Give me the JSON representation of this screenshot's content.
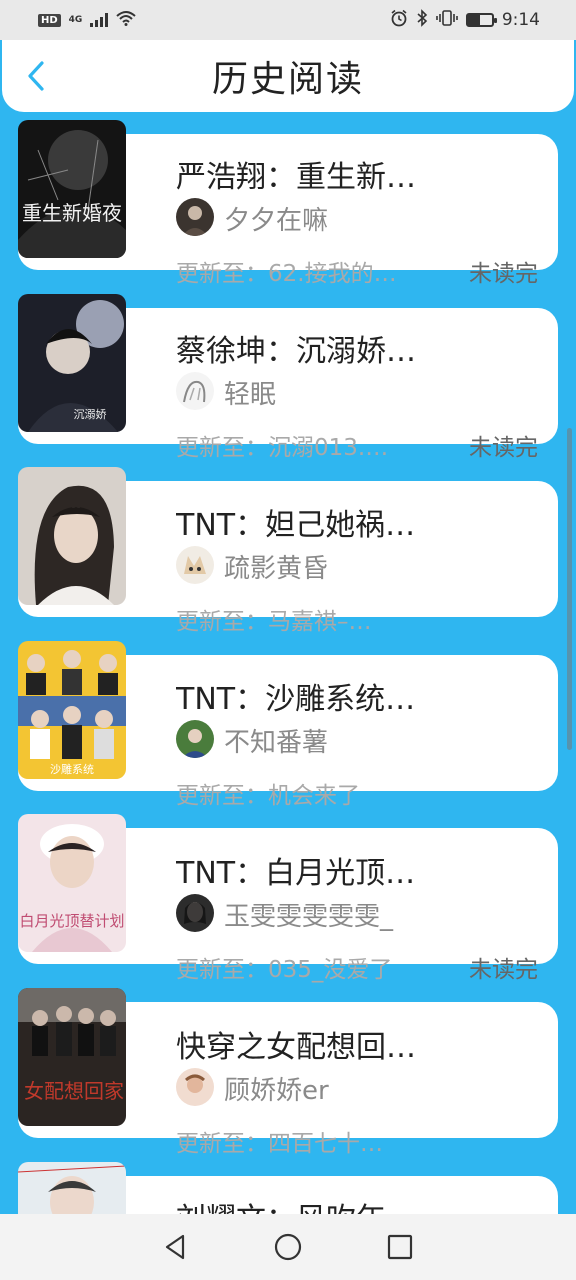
{
  "status_bar": {
    "hd": "HD",
    "network": "4G",
    "time": "9:14",
    "battery_level": 0.5,
    "icons": [
      "signal-icon",
      "wifi-icon",
      "alarm-icon",
      "bluetooth-icon",
      "vibrate-icon",
      "battery-icon"
    ]
  },
  "header": {
    "back_icon": "chevron-left-icon",
    "title": "历史阅读",
    "accent": "#2fb6f0"
  },
  "books": [
    {
      "title": "严浩翔：重生新…",
      "author": "夕夕在嘛",
      "update": "更新至：62.接我的…",
      "status": "未读完"
    },
    {
      "title": "蔡徐坤：沉溺娇…",
      "author": "轻眠",
      "update": "更新至：沉溺013.…",
      "status": "未读完"
    },
    {
      "title": "TNT：妲己她祸…",
      "author": "疏影黄昏",
      "update": "更新至：马嘉祺–…",
      "status": ""
    },
    {
      "title": "TNT：沙雕系统…",
      "author": "不知番薯",
      "update": "更新至：机会来了",
      "status": ""
    },
    {
      "title": "TNT：白月光顶…",
      "author": "玉雯雯雯雯雯_",
      "update": "更新至：035_没爱了",
      "status": "未读完"
    },
    {
      "title": "快穿之女配想回…",
      "author": "顾娇娇er",
      "update": "更新至：四百七十…",
      "status": ""
    },
    {
      "title": "刘耀文：风吹年",
      "author": "",
      "update": "",
      "status": ""
    }
  ],
  "covers": [
    {
      "text": "重生新婚夜",
      "colors": [
        "#1a1a1a",
        "#5a5a5a"
      ]
    },
    {
      "text": "沉溺娇",
      "colors": [
        "#1c1c26",
        "#6b6f80"
      ]
    },
    {
      "text": "",
      "colors": [
        "#d8d2cc",
        "#3a3330"
      ]
    },
    {
      "text": "沙雕系统",
      "colors": [
        "#f2c230",
        "#4a6fa8"
      ]
    },
    {
      "text": "白月光顶替计划",
      "colors": [
        "#f4e6ea",
        "#c25c7a"
      ]
    },
    {
      "text": "女配想回家",
      "colors": [
        "#2b2522",
        "#c0392b"
      ]
    },
    {
      "text": "",
      "colors": [
        "#e8eef2",
        "#9a9a9a"
      ]
    }
  ],
  "nav": {
    "back_icon": "triangle-back-icon",
    "home_icon": "circle-home-icon",
    "recent_icon": "square-recent-icon"
  }
}
